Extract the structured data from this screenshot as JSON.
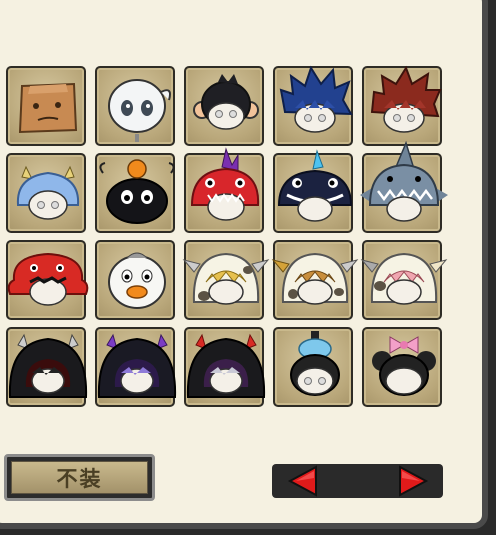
{
  "panel": {
    "no_costume_button": {
      "label": "不装"
    }
  },
  "costumes": [
    {
      "name": "paper-bag-mask-icon"
    },
    {
      "name": "ghost-skull-mask-icon"
    },
    {
      "name": "monkey-hood-icon"
    },
    {
      "name": "blue-spiky-hair-icon"
    },
    {
      "name": "red-spiky-hair-icon"
    },
    {
      "name": "blue-horned-hair-icon"
    },
    {
      "name": "black-pumpkin-blob-icon"
    },
    {
      "name": "red-dragon-hood-icon"
    },
    {
      "name": "navy-whale-hood-icon"
    },
    {
      "name": "shark-hood-icon"
    },
    {
      "name": "red-octopus-hood-icon"
    },
    {
      "name": "white-duck-hood-icon"
    },
    {
      "name": "cow-hood-blonde-icon"
    },
    {
      "name": "cow-hood-brown-icon"
    },
    {
      "name": "cow-hood-pink-icon"
    },
    {
      "name": "black-devil-hood-red-icon"
    },
    {
      "name": "black-devil-hood-purple-icon"
    },
    {
      "name": "black-devil-hood-silver-icon"
    },
    {
      "name": "blue-bun-top-icon"
    },
    {
      "name": "pink-bow-ears-icon"
    }
  ],
  "colors": {
    "panel_bg": "#f5f1e1",
    "slot_bg": "#b9a77a",
    "arrow_red": "#e01a1a"
  }
}
